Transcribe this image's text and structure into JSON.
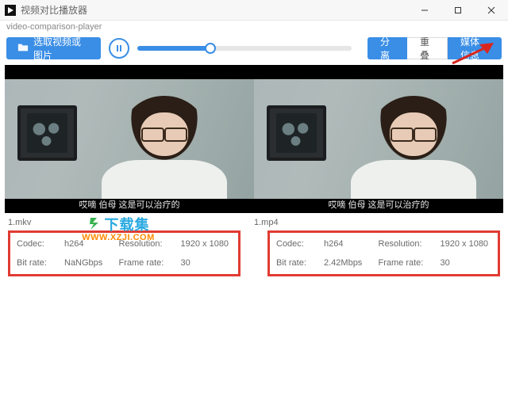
{
  "window": {
    "title": "视频对比播放器"
  },
  "appSubtitle": "video-comparison-player",
  "toolbar": {
    "select_label": "选取视频或图片",
    "split_label": "分离",
    "overlay_label": "重叠",
    "media_info_label": "媒体信息"
  },
  "video": {
    "subtitle": "哎嘀 伯母 这是可以治疗的"
  },
  "panes": [
    {
      "filename": "1.mkv",
      "info": {
        "codec_label": "Codec:",
        "codec_value": "h264",
        "resolution_label": "Resolution:",
        "resolution_value": "1920 x 1080",
        "bitrate_label": "Bit rate:",
        "bitrate_value": "NaNGbps",
        "framerate_label": "Frame rate:",
        "framerate_value": "30"
      }
    },
    {
      "filename": "1.mp4",
      "info": {
        "codec_label": "Codec:",
        "codec_value": "h264",
        "resolution_label": "Resolution:",
        "resolution_value": "1920 x 1080",
        "bitrate_label": "Bit rate:",
        "bitrate_value": "2.42Mbps",
        "framerate_label": "Frame rate:",
        "framerate_value": "30"
      }
    }
  ],
  "watermark": {
    "line1": "下载集",
    "line2": "WWW.XZJI.COM"
  }
}
